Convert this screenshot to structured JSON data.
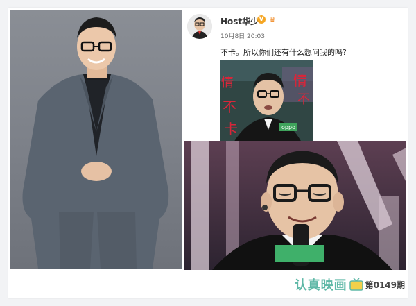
{
  "post": {
    "username": "Host华少",
    "verified_mark": "V",
    "timestamp": "10月8日 20:03",
    "text": "不卡。所以你们还有什么想问我的吗?",
    "image_overlay_chars": [
      "情",
      "不",
      "卡",
      "不",
      "情"
    ],
    "mic_badge_text": "oppo"
  },
  "watermark": {
    "brand": "认真映画",
    "issue": "第0149期"
  },
  "colors": {
    "brand": "#5fb8a7",
    "verified": "#f5a623",
    "caption_bar": "#3fb06a"
  }
}
